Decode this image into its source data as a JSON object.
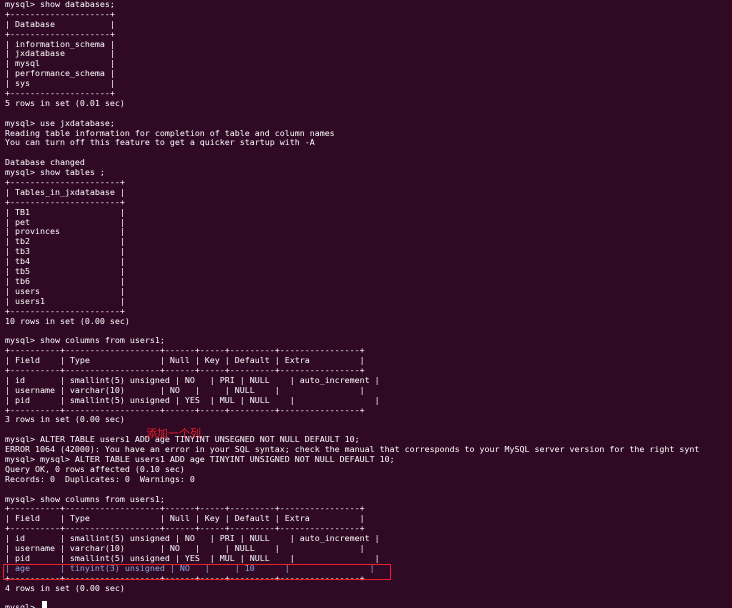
{
  "terminal": {
    "lines": [
      "mysql> show databases;",
      "+--------------------+",
      "| Database           |",
      "+--------------------+",
      "| information_schema |",
      "| jxdatabase         |",
      "| mysql              |",
      "| performance_schema |",
      "| sys                |",
      "+--------------------+",
      "5 rows in set (0.01 sec)",
      "",
      "mysql> use jxdatabase;",
      "Reading table information for completion of table and column names",
      "You can turn off this feature to get a quicker startup with -A",
      "",
      "Database changed",
      "mysql> show tables ;",
      "+----------------------+",
      "| Tables_in_jxdatabase |",
      "+----------------------+",
      "| TB1                  |",
      "| pet                  |",
      "| provinces            |",
      "| tb2                  |",
      "| tb3                  |",
      "| tb4                  |",
      "| tb5                  |",
      "| tb6                  |",
      "| users                |",
      "| users1               |",
      "+----------------------+",
      "10 rows in set (0.00 sec)",
      "",
      "mysql> show columns from users1;",
      "+----------+-------------------+------+-----+---------+----------------+",
      "| Field    | Type              | Null | Key | Default | Extra          |",
      "+----------+-------------------+------+-----+---------+----------------+",
      "| id       | smallint(5) unsigned | NO   | PRI | NULL    | auto_increment |",
      "| username | varchar(10)       | NO   |     | NULL    |                |",
      "| pid      | smallint(5) unsigned | YES  | MUL | NULL    |                |",
      "+----------+-------------------+------+-----+---------+----------------+",
      "3 rows in set (0.00 sec)",
      "",
      "mysql> ALTER TABLE users1 ADD age TINYINT UNSEGNED NOT NULL DEFAULT 10;",
      "ERROR 1064 (42000): You have an error in your SQL syntax; check the manual that corresponds to your MySQL server version for the right synt",
      "mysql> mysql> ALTER TABLE users1 ADD age TINYINT UNSIGNED NOT NULL DEFAULT 10;",
      "Query OK, 0 rows affected (0.10 sec)",
      "Records: 0  Duplicates: 0  Warnings: 0",
      "",
      "mysql> show columns from users1;",
      "+----------+-------------------+------+-----+---------+----------------+",
      "| Field    | Type              | Null | Key | Default | Extra          |",
      "+----------+-------------------+------+-----+---------+----------------+",
      "| id       | smallint(5) unsigned | NO   | PRI | NULL    | auto_increment |",
      "| username | varchar(10)       | NO   |     | NULL    |                |",
      "| pid      | smallint(5) unsigned | YES  | MUL | NULL    |                |",
      "| age      | tinyint(3) unsigned | NO   |     | 10      |                |",
      "+----------+-------------------+------+-----+---------+----------------+",
      "4 rows in set (0.00 sec)",
      "",
      "mysql> "
    ],
    "annotation": "添加一个列",
    "colors": {
      "background": "#300a24",
      "text": "#ffffff",
      "highlighted_text": "#8fa8e0",
      "annotation": "#e8202a"
    }
  }
}
